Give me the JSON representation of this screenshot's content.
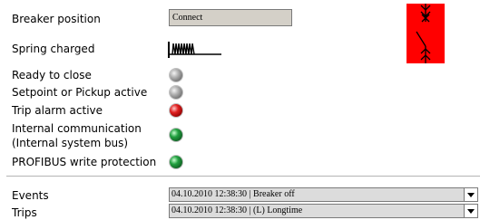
{
  "status": {
    "breaker_position": {
      "label": "Breaker position",
      "value": "Connect"
    },
    "spring_charged": {
      "label": "Spring charged"
    },
    "indicators": [
      {
        "label": "Ready to close",
        "state": "grey"
      },
      {
        "label": "Setpoint or Pickup active",
        "state": "grey"
      },
      {
        "label": "Trip alarm active",
        "state": "red"
      },
      {
        "label_line1": "Internal communication",
        "label_line2": "(Internal system bus)",
        "state": "green"
      },
      {
        "label": "PROFIBUS write protection",
        "state": "green"
      }
    ]
  },
  "breaker_symbol": {
    "color": "#ff0000"
  },
  "logs": {
    "events": {
      "label": "Events",
      "value": "04.10.2010 12:38:30 | Breaker off"
    },
    "trips": {
      "label": "Trips",
      "value": "04.10.2010 12:38:30 | (L) Longtime"
    }
  },
  "icons": [
    "spring-charged-icon",
    "breaker-switch-icon",
    "dropdown-arrow-icon"
  ]
}
